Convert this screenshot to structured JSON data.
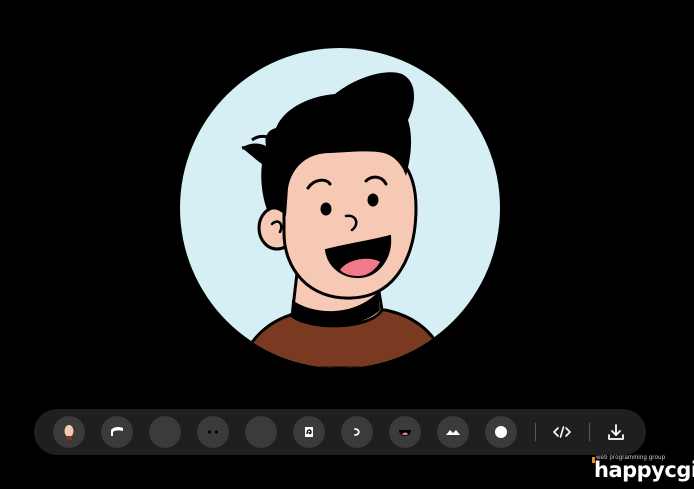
{
  "avatar": {
    "background_color": "#d6eff4",
    "skin_color": "#f6c9b4",
    "hair_color": "#000000",
    "shirt_color": "#7a3a22",
    "mouth_color": "#000000",
    "tongue_color": "#f07a8a"
  },
  "toolbar": {
    "items": [
      {
        "name": "face-option-icon"
      },
      {
        "name": "hair-option-icon"
      },
      {
        "name": "blank-option-icon"
      },
      {
        "name": "eyes-option-icon"
      },
      {
        "name": "blank-option-icon-2"
      },
      {
        "name": "ear-option-icon"
      },
      {
        "name": "nose-option-icon"
      },
      {
        "name": "mouth-option-icon"
      },
      {
        "name": "beard-option-icon"
      },
      {
        "name": "color-option-icon"
      }
    ],
    "actions": [
      {
        "name": "code-icon"
      },
      {
        "name": "download-icon"
      }
    ]
  },
  "brand": {
    "tagline": "web programming group",
    "name": "happycgi",
    "accent_color": "#f08a1c"
  }
}
